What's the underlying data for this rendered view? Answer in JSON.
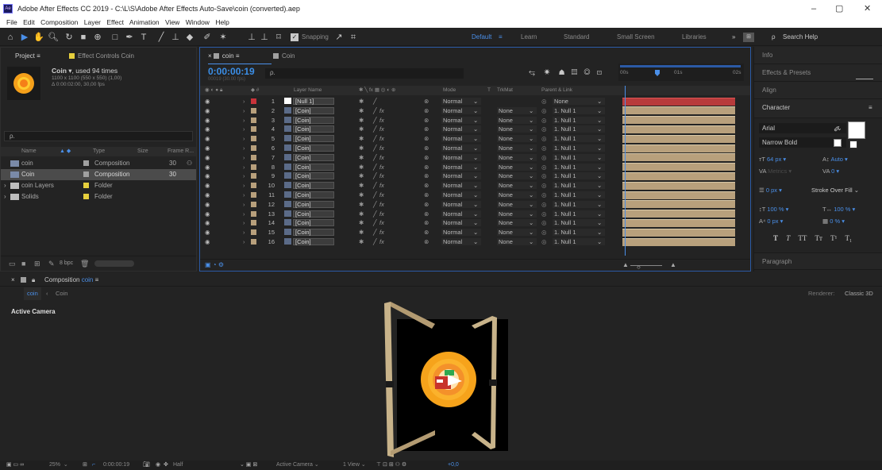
{
  "window": {
    "title": "Adobe After Effects CC 2019 - C:\\L\\S\\Adobe After Effects Auto-Save\\coin (converted).aep",
    "controls": [
      "–",
      "▢",
      "✕"
    ]
  },
  "menu": [
    "File",
    "Edit",
    "Composition",
    "Layer",
    "Effect",
    "Animation",
    "View",
    "Window",
    "Help"
  ],
  "toolbar": {
    "snapping_label": "Snapping",
    "workspaces": [
      "Default",
      "Learn",
      "Standard",
      "Small Screen",
      "Libraries"
    ],
    "active_workspace": "Default",
    "search_placeholder": "Search Help",
    "more": "»"
  },
  "project": {
    "tabs": [
      "Project",
      "Effect Controls Coin"
    ],
    "item_name": "Coin",
    "usage": ", used 94 times",
    "dims": "1100 x 1100  (550 x 550) (1,00)",
    "duration": "Δ 0:00:02:00, 30,00 fps",
    "search_placeholder": "ρ.",
    "columns": [
      "Name",
      "Type",
      "Size",
      "Frame R..."
    ],
    "items": [
      {
        "name": "coin",
        "type": "Composition",
        "fps": "30",
        "color": "#a0a0a0",
        "selected": false
      },
      {
        "name": "Coin",
        "type": "Composition",
        "fps": "30",
        "color": "#a0a0a0",
        "selected": true
      },
      {
        "name": "coin Layers",
        "type": "Folder",
        "fps": "",
        "color": "#e6cf3d",
        "selected": false
      },
      {
        "name": "Solids",
        "type": "Folder",
        "fps": "",
        "color": "#e6cf3d",
        "selected": false
      }
    ],
    "bpc": "8 bpc"
  },
  "timeline": {
    "tabs": [
      "coin",
      "Coin"
    ],
    "timecode": "0:00:00:19",
    "frame_info": "00019 (30.00 fps)",
    "search_placeholder": "ρ.",
    "headers": {
      "layer_name": "Layer Name",
      "mode": "Mode",
      "t": "T",
      "trkmat": "TrkMat",
      "parent": "Parent & Link"
    },
    "ruler": [
      "00s",
      "01s",
      "02s"
    ],
    "layers": [
      {
        "num": "1",
        "name": "[Null 1]",
        "mode": "Normal",
        "trkmat": "",
        "parent": "None",
        "color": "#c8333a"
      },
      {
        "num": "2",
        "name": "[Coin]",
        "mode": "Normal",
        "trkmat": "None",
        "parent": "1. Null 1",
        "color": "#b8a07c"
      },
      {
        "num": "3",
        "name": "[Coin]",
        "mode": "Normal",
        "trkmat": "None",
        "parent": "1. Null 1",
        "color": "#b8a07c"
      },
      {
        "num": "4",
        "name": "[Coin]",
        "mode": "Normal",
        "trkmat": "None",
        "parent": "1. Null 1",
        "color": "#b8a07c"
      },
      {
        "num": "5",
        "name": "[Coin]",
        "mode": "Normal",
        "trkmat": "None",
        "parent": "1. Null 1",
        "color": "#b8a07c"
      },
      {
        "num": "6",
        "name": "[Coin]",
        "mode": "Normal",
        "trkmat": "None",
        "parent": "1. Null 1",
        "color": "#b8a07c"
      },
      {
        "num": "7",
        "name": "[Coin]",
        "mode": "Normal",
        "trkmat": "None",
        "parent": "1. Null 1",
        "color": "#b8a07c"
      },
      {
        "num": "8",
        "name": "[Coin]",
        "mode": "Normal",
        "trkmat": "None",
        "parent": "1. Null 1",
        "color": "#b8a07c"
      },
      {
        "num": "9",
        "name": "[Coin]",
        "mode": "Normal",
        "trkmat": "None",
        "parent": "1. Null 1",
        "color": "#b8a07c"
      },
      {
        "num": "10",
        "name": "[Coin]",
        "mode": "Normal",
        "trkmat": "None",
        "parent": "1. Null 1",
        "color": "#b8a07c"
      },
      {
        "num": "11",
        "name": "[Coin]",
        "mode": "Normal",
        "trkmat": "None",
        "parent": "1. Null 1",
        "color": "#b8a07c"
      },
      {
        "num": "12",
        "name": "[Coin]",
        "mode": "Normal",
        "trkmat": "None",
        "parent": "1. Null 1",
        "color": "#b8a07c"
      },
      {
        "num": "13",
        "name": "[Coin]",
        "mode": "Normal",
        "trkmat": "None",
        "parent": "1. Null 1",
        "color": "#b8a07c"
      },
      {
        "num": "14",
        "name": "[Coin]",
        "mode": "Normal",
        "trkmat": "None",
        "parent": "1. Null 1",
        "color": "#b8a07c"
      },
      {
        "num": "15",
        "name": "[Coin]",
        "mode": "Normal",
        "trkmat": "None",
        "parent": "1. Null 1",
        "color": "#b8a07c"
      },
      {
        "num": "16",
        "name": "[Coin]",
        "mode": "Normal",
        "trkmat": "None",
        "parent": "1. Null 1",
        "color": "#b8a07c"
      }
    ]
  },
  "right_panel": {
    "sections": [
      "Info",
      "Effects & Presets",
      "Align",
      "Character",
      "Paragraph"
    ],
    "font": "Arial",
    "style": "Narrow Bold",
    "size": "64 px",
    "leading": "Auto",
    "kerning": "Metrics",
    "tracking": "0",
    "stroke_width": "0 px",
    "stroke_mode": "Stroke Over Fill",
    "v_scale": "100 %",
    "h_scale": "100 %",
    "baseline": "0 px",
    "tsume": "0 %",
    "type_buttons": [
      "T",
      "T",
      "TT",
      "Tт",
      "T¹",
      "T₁"
    ]
  },
  "composition": {
    "tab_label": "Composition",
    "tab_name": "coin",
    "breadcrumbs": [
      "coin",
      "Coin"
    ],
    "renderer_label": "Renderer:",
    "renderer": "Classic 3D",
    "view_label": "Active Camera"
  },
  "viewer_bar": {
    "zoom": "25%",
    "time": "0:00:00:19",
    "resolution": "Half",
    "camera": "Active Camera",
    "views": "1 View",
    "exposure": "+0,0"
  },
  "colors": {
    "accent": "#4a8fe8",
    "timecode": "#3b8fe8",
    "label_red": "#c8333a",
    "label_tan": "#b8a07c"
  }
}
